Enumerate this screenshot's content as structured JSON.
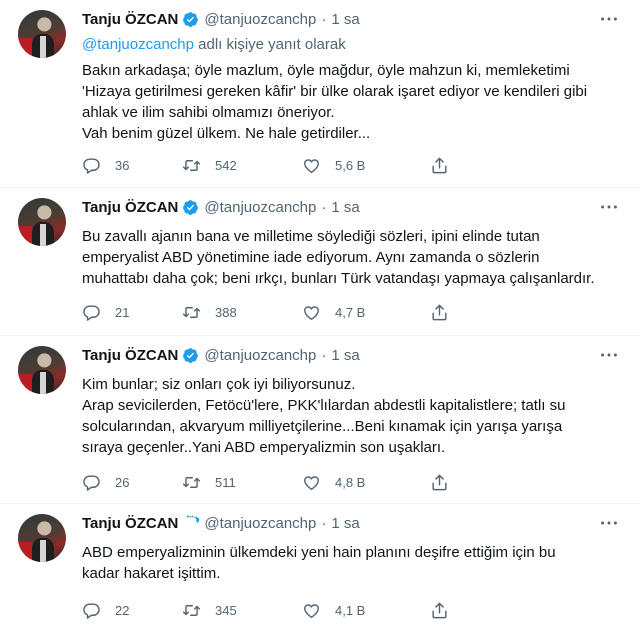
{
  "tweets": [
    {
      "name": "Tanju ÖZCAN",
      "handle": "@tanjuozcanchp",
      "dot": "·",
      "time": "1 sa",
      "reply_link": "@tanjuozcanchp",
      "reply_suffix": " adlı kişiye yanıt olarak",
      "lines": [
        "Bakın arkadaşa; öyle mazlum, öyle mağdur, öyle mahzun ki, memleketimi",
        "'Hizaya getirilmesi gereken kâfir' bir ülke olarak işaret ediyor ve kendileri gibi",
        "ahlak ve ilim sahibi olmamızı öneriyor.",
        "Vah benim güzel ülkem. Ne hale getirdiler..."
      ],
      "replies": "36",
      "retweets": "542",
      "likes": "5,6 B"
    },
    {
      "name": "Tanju ÖZCAN",
      "handle": "@tanjuozcanchp",
      "dot": "·",
      "time": "1 sa",
      "lines": [
        "Bu zavallı ajanın bana ve milletime söylediği sözleri, ipini elinde tutan",
        "emperyalist ABD yönetimine iade ediyorum. Aynı zamanda o sözlerin",
        "muhattabı daha çok; beni ırkçı, bunları  Türk vatandaşı yapmaya çalışanlardır."
      ],
      "replies": "21",
      "retweets": "388",
      "likes": "4,7 B"
    },
    {
      "name": "Tanju ÖZCAN",
      "handle": "@tanjuozcanchp",
      "dot": "·",
      "time": "1 sa",
      "lines": [
        "Kim bunlar; siz onları çok iyi biliyorsunuz.",
        "Arap sevicilerden, Fetöcü'lere, PKK'lılardan abdestli kapitalistlere; tatlı su",
        "solcularından, akvaryum milliyetçilerine...Beni kınamak için yarışa yarışa",
        "sıraya geçenler..Yani ABD emperyalizmin son uşakları."
      ],
      "replies": "26",
      "retweets": "511",
      "likes": "4,8 B"
    },
    {
      "name": "Tanju ÖZCAN",
      "handle": "@tanjuozcanchp",
      "dot": "·",
      "time": "1 sa",
      "lines": [
        "ABD emperyalizminin ülkemdeki yeni hain planını deşifre ettiğim için bu",
        "kadar hakaret işittim."
      ],
      "replies": "22",
      "retweets": "345",
      "likes": "4,1 B"
    }
  ],
  "icons": {
    "verified": "verified-badge-icon",
    "more": "more-options-icon",
    "reply": "reply-icon",
    "retweet": "retweet-icon",
    "like": "like-icon",
    "share": "share-icon"
  },
  "colors": {
    "accent": "#1d9bf0",
    "secondary_text": "#536471",
    "text": "#0f1419"
  }
}
